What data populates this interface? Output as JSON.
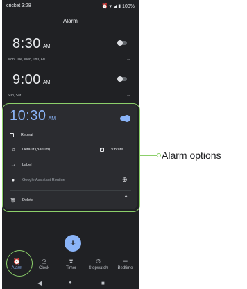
{
  "status": {
    "carrier_time": "cricket 3:28",
    "battery": "100%"
  },
  "app": {
    "title": "Alarm"
  },
  "alarms": [
    {
      "time": "8:30",
      "ampm": "AM",
      "days": "Mon, Tue, Wed, Thu, Fri",
      "enabled": false
    },
    {
      "time": "9:00",
      "ampm": "AM",
      "days": "Sun, Sat",
      "enabled": false
    }
  ],
  "expanded_alarm": {
    "time": "10:30",
    "ampm": "AM",
    "enabled": true,
    "repeat_label": "Repeat",
    "ringtone_label": "Default (Barium)",
    "vibrate_label": "Vibrate",
    "vibrate_checked": true,
    "label_label": "Label",
    "routine_label": "Google Assistant Routine",
    "delete_label": "Delete"
  },
  "fab": {
    "label": "+"
  },
  "bottom_nav": [
    {
      "label": "Alarm",
      "icon": "alarm-icon",
      "active": true
    },
    {
      "label": "Clock",
      "icon": "clock-icon",
      "active": false
    },
    {
      "label": "Timer",
      "icon": "hourglass-icon",
      "active": false
    },
    {
      "label": "Stopwatch",
      "icon": "stopwatch-icon",
      "active": false
    },
    {
      "label": "Bedtime",
      "icon": "bed-icon",
      "active": false
    }
  ],
  "annotation": {
    "text": "Alarm options"
  },
  "colors": {
    "accent": "#8ab4f8",
    "background": "#202124",
    "highlight": "#8ccf6a"
  }
}
